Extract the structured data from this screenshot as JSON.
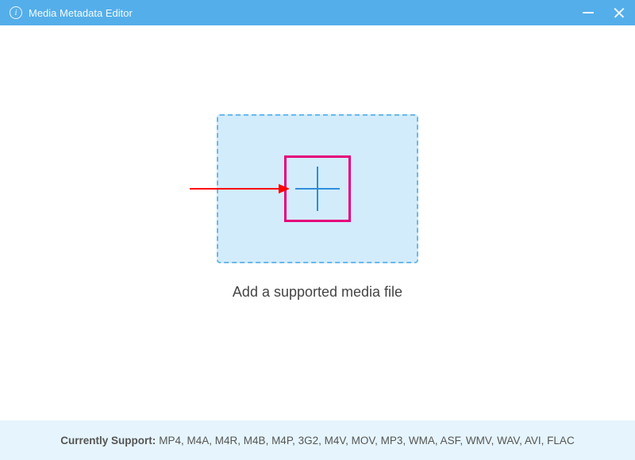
{
  "titlebar": {
    "title": "Media Metadata Editor"
  },
  "main": {
    "instruction": "Add a supported media file"
  },
  "footer": {
    "label": "Currently Support:",
    "formats": "MP4, M4A, M4R, M4B, M4P, 3G2, M4V, MOV, MP3, WMA, ASF, WMV, WAV, AVI, FLAC"
  }
}
